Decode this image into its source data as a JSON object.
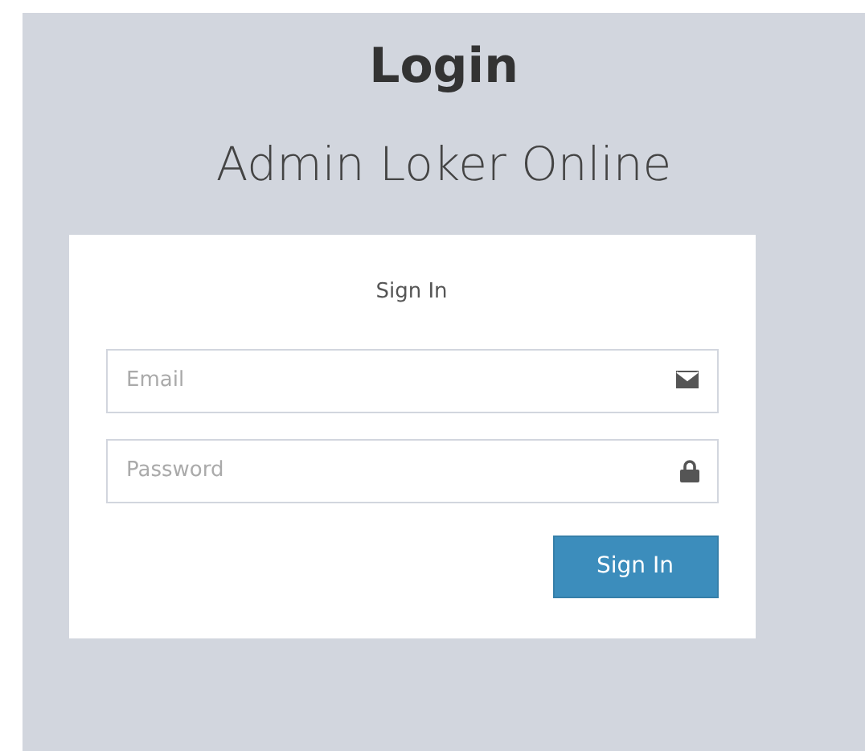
{
  "header": {
    "title": "Login",
    "subtitle": "Admin Loker Online"
  },
  "form": {
    "heading": "Sign In",
    "fields": [
      {
        "kind": "email",
        "placeholder": "Email"
      },
      {
        "kind": "password",
        "placeholder": "Password"
      }
    ],
    "button": "Sign In"
  }
}
